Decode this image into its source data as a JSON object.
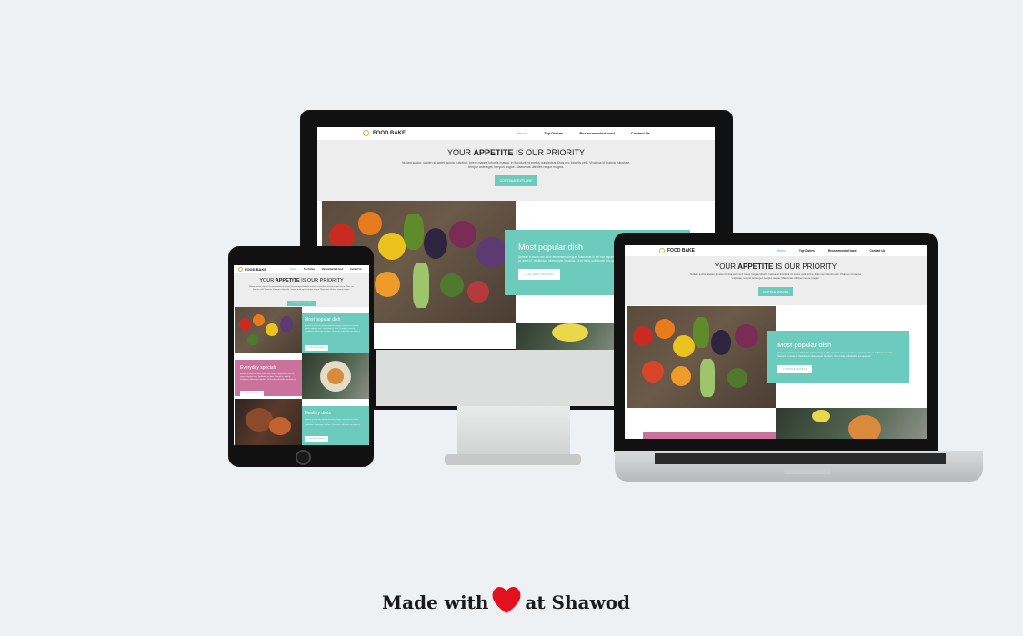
{
  "site": {
    "brand": "FOOD BAKE",
    "nav": [
      "Home",
      "Top Dishes",
      "Recommended food",
      "Contact Us"
    ],
    "hero_title_pre": "YOUR ",
    "hero_title_bold": "APPETITE",
    "hero_title_post": " IS OUR PRIORITY",
    "hero_text": "Nullam auctor, sapien sit amet lacinia euismod, lorem magna lobortis massa, in tincidunt mi metus quis lectus. Duis nec lobortis velit. Vivamus id magna vulputate, tempor ante eget, tempus augue. Maecenas ultricies neque magna.",
    "hero_button": "CONTINUE EXPLORE",
    "card1_title": "Most popular dish",
    "card1_text": "Aenean in lacus nec dolor fermentum congue. Maecenas in est nec sapien vulputate velit. Vestibulum ac dolor. Suscipit ac amet id. Vestibulum ullamcorper faucibus. Ut et mola, sollicitudin non quam et.",
    "card_button": "CONTINUE READING",
    "card2_title": "Everyday specials",
    "card3_title": "Healthy diets"
  },
  "tablet_nav": [
    "Home",
    "Top dishes",
    "Recommended food",
    "Contact Us"
  ],
  "footer": {
    "made_with": "Made with",
    "at": "at Shawod"
  },
  "colors": {
    "teal": "#6ccbbd",
    "pink": "#c9729c",
    "heart": "#e3101f"
  }
}
